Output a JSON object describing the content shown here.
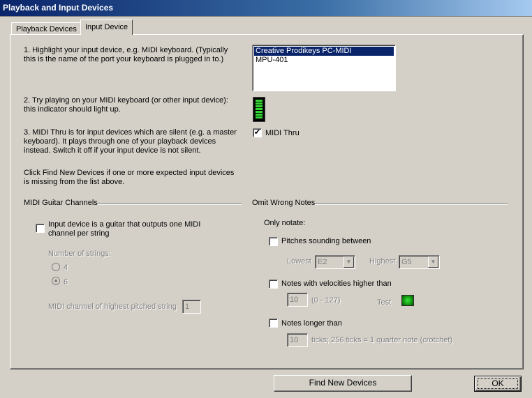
{
  "window": {
    "title": "Playback and Input Devices"
  },
  "tabs": {
    "playback": "Playback Devices",
    "input": "Input Device"
  },
  "steps": {
    "step1": "1. Highlight your input device, e.g. MIDI keyboard. (Typically this is the name of the port your keyboard is plugged in to.)",
    "step2": "2. Try playing on your MIDI keyboard (or other input device): this indicator should light up.",
    "step3": "3. MIDI Thru is for input devices which are silent (e.g. a master keyboard). It plays through one of your playback devices instead. Switch it off if your input device is not silent.",
    "find_note": "Click Find New Devices if one or more expected input devices is missing from the list above."
  },
  "devices": {
    "items": [
      "Creative Prodikeys PC-MIDI",
      "MPU-401"
    ],
    "selected_index": 0
  },
  "indicator": {
    "level": 1.0,
    "color": "#33d733"
  },
  "midi_thru": {
    "label": "MIDI Thru",
    "checked": true
  },
  "guitar": {
    "section_title": "MIDI Guitar Channels",
    "checkbox_label": "Input device is a guitar that outputs one MIDI channel per string",
    "checked": false,
    "strings_label": "Number of strings:",
    "option_4": "4",
    "option_6": "6",
    "selected": "6",
    "channel_label": "MIDI channel of highest pitched string",
    "channel_value": "1"
  },
  "omit": {
    "section_title": "Omit Wrong Notes",
    "only_notate": "Only notate:",
    "pitches_label": "Pitches sounding between",
    "pitches_checked": false,
    "lowest_label": "Lowest",
    "lowest_value": "E2",
    "highest_label": "Highest",
    "highest_value": "G5",
    "velocities_label": "Notes with velocities higher than",
    "velocities_checked": false,
    "velocity_value": "10",
    "velocity_range": "(0 - 127)",
    "test_label": "Test",
    "test_led_color": "#3fe63f",
    "longer_label": "Notes longer than",
    "longer_checked": false,
    "ticks_value": "10",
    "ticks_note": "ticks; 256 ticks = 1 quarter note (crotchet)"
  },
  "buttons": {
    "find_new": "Find New Devices",
    "ok": "OK"
  }
}
